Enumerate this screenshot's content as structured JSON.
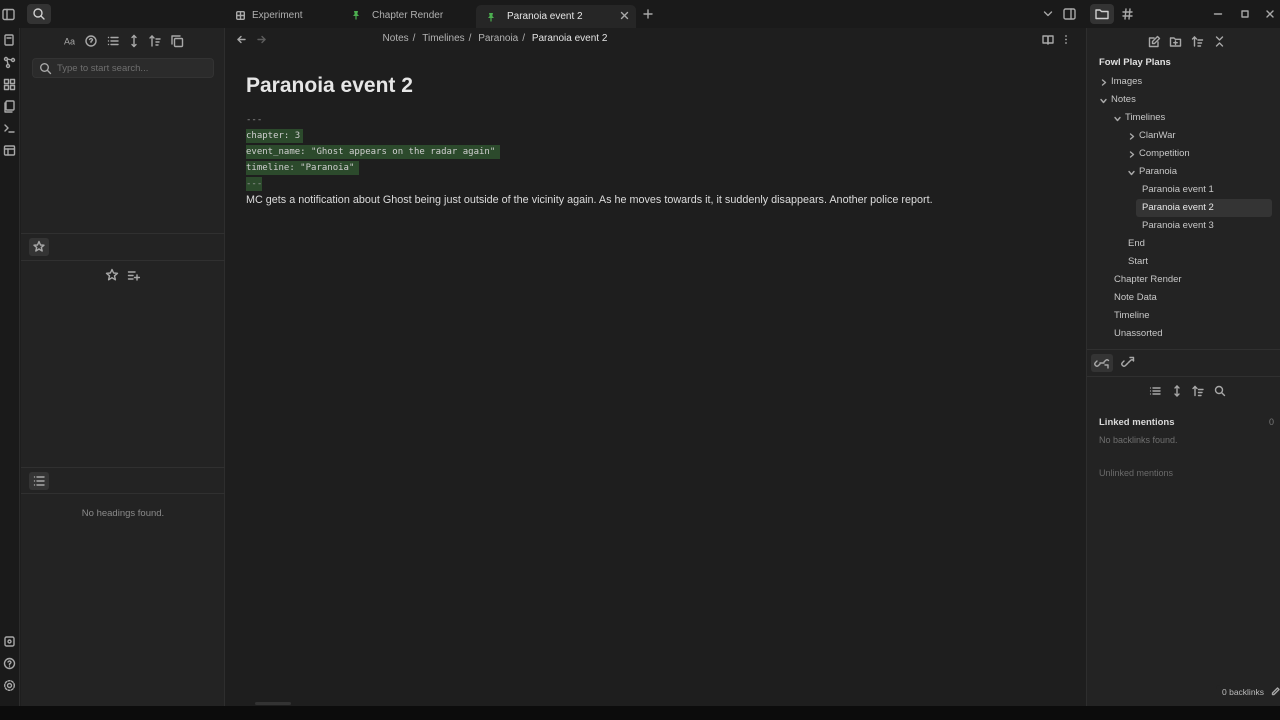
{
  "tabs": [
    {
      "label": "Experiment",
      "icon": "layout-icon"
    },
    {
      "label": "Chapter Render",
      "icon": "pin-icon"
    },
    {
      "label": "Paranoia event 2",
      "icon": "pin-icon"
    }
  ],
  "search": {
    "placeholder": "Type to start search..."
  },
  "outline": {
    "empty_text": "No headings found."
  },
  "breadcrumb": [
    "Notes",
    "Timelines",
    "Paranoia",
    "Paranoia event 2"
  ],
  "note": {
    "title": "Paranoia event 2",
    "frontmatter": [
      "---",
      "chapter: 3",
      "event_name: \"Ghost appears on the radar again\"",
      "timeline: \"Paranoia\"",
      "---"
    ],
    "body": "MC gets a notification about Ghost being just outside of the vicinity again. As he moves towards it, it suddenly disappears. Another police report."
  },
  "explorer": {
    "vault": "Fowl Play Plans",
    "items": [
      {
        "label": "Images"
      },
      {
        "label": "Notes"
      },
      {
        "label": "Timelines"
      },
      {
        "label": "ClanWar"
      },
      {
        "label": "Competition"
      },
      {
        "label": "Paranoia"
      },
      {
        "label": "Paranoia event 1"
      },
      {
        "label": "Paranoia event 2"
      },
      {
        "label": "Paranoia event 3"
      },
      {
        "label": "End"
      },
      {
        "label": "Start"
      },
      {
        "label": "Chapter Render"
      },
      {
        "label": "Note Data"
      },
      {
        "label": "Timeline"
      },
      {
        "label": "Unassorted"
      }
    ]
  },
  "backlinks": {
    "linked_title": "Linked mentions",
    "linked_count": "0",
    "linked_empty": "No backlinks found.",
    "unlinked_title": "Unlinked mentions"
  },
  "status": {
    "backlinks": "0 backlinks"
  },
  "colors": {
    "accent_green": "#4caf50",
    "highlight": "#2c4a2c"
  }
}
